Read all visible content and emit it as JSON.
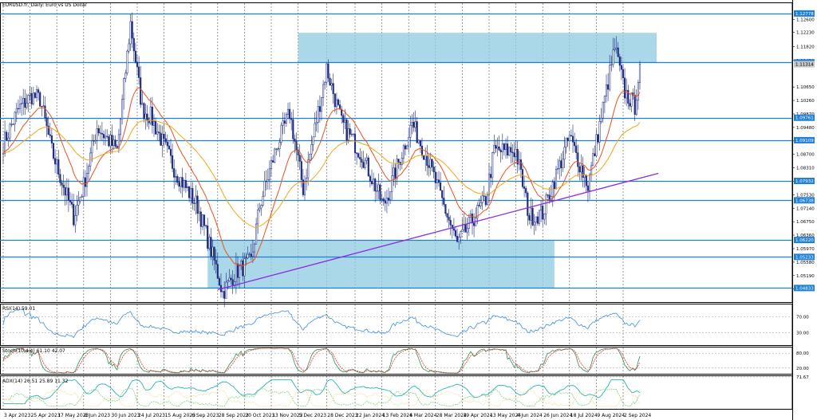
{
  "title": "EURUSD.fr, Daily: Euro vs US Dollar",
  "colors": {
    "bull": "#1c2a80",
    "bear": "#1c2a80",
    "level": "#1e7fd6",
    "zone": "#8fcbe0",
    "ema_fast": "#e8521d",
    "ema_slow": "#f2a619",
    "trendline": "#8a2be2",
    "rsi": "#3a8ee6",
    "stoch_main": "#2e8b57",
    "stoch_signal": "#d33",
    "adx": "#1aa",
    "plus_di": "#7fd27f",
    "minus_di": "#f5d37a"
  },
  "price_axis": {
    "min": 1.044,
    "max": 1.131,
    "ticks": [
      "1.12600",
      "1.12230",
      "1.11820",
      "1.11420",
      "1.10650",
      "1.10260",
      "1.09870",
      "1.09480",
      "1.09090",
      "1.08700",
      "1.08310",
      "1.07920",
      "1.07530",
      "1.07140",
      "1.06750",
      "1.06360",
      "1.05970",
      "1.05580",
      "1.05190",
      "1.04800"
    ]
  },
  "levels": [
    {
      "price": 1.1278,
      "label": "1.12778"
    },
    {
      "price": 1.1136,
      "label": "1.11363"
    },
    {
      "price": 1.0976,
      "label": "1.09761"
    },
    {
      "price": 1.0911,
      "label": "1.09109"
    },
    {
      "price": 1.0793,
      "label": "1.07932"
    },
    {
      "price": 1.0737,
      "label": "1.06738"
    },
    {
      "price": 1.0622,
      "label": "1.06220"
    },
    {
      "price": 1.0573,
      "label": "1.05233"
    },
    {
      "price": 1.0483,
      "label": "1.04833"
    }
  ],
  "current_price": {
    "price": 1.1131,
    "label": "1.11314"
  },
  "x_axis": {
    "labels": [
      "3 Apr 2023",
      "25 Apr 2023",
      "17 May 2023",
      "8 Jun 2023",
      "30 Jun 2023",
      "24 Jul 2023",
      "15 Aug 2023",
      "6 Sep 2023",
      "28 Sep 2023",
      "20 Oct 2023",
      "13 Nov 2023",
      "5 Dec 2023",
      "28 Dec 2023",
      "22 Jan 2024",
      "13 Feb 2024",
      "6 Mar 2024",
      "28 Mar 2024",
      "19 Apr 2024",
      "13 May 2024",
      "4 Jun 2024",
      "26 Jun 2024",
      "18 Jul 2024",
      "9 Aug 2024",
      "2 Sep 2024"
    ]
  },
  "indicators": {
    "rsi": {
      "label": "RSI(14) 59.01",
      "ticks": [
        "100.00",
        "70.00",
        "30.00",
        "0.00"
      ],
      "value": 59.01
    },
    "stoch": {
      "label": "Stoch(10,4,4) 61.10 42.07",
      "ticks": [
        "100.00",
        "80.00",
        "20.00",
        "0.00"
      ],
      "main": 61.1,
      "signal": 42.07
    },
    "adx": {
      "label": "ADX(14) 26.51 25.89 11.32",
      "ticks": [
        "71.67",
        "0.00"
      ],
      "adx": 26.51,
      "plus_di": 25.89,
      "minus_di": 11.32
    }
  },
  "chart_data": {
    "type": "candlestick",
    "title": "EURUSD.fr, Daily: Euro vs US Dollar",
    "x": [
      "3 Apr 2023",
      "25 Apr 2023",
      "17 May 2023",
      "8 Jun 2023",
      "30 Jun 2023",
      "24 Jul 2023",
      "15 Aug 2023",
      "6 Sep 2023",
      "28 Sep 2023",
      "20 Oct 2023",
      "13 Nov 2023",
      "5 Dec 2023",
      "28 Dec 2023",
      "22 Jan 2024",
      "13 Feb 2024",
      "6 Mar 2024",
      "28 Mar 2024",
      "19 Apr 2024",
      "13 May 2024",
      "4 Jun 2024",
      "26 Jun 2024",
      "18 Jul 2024",
      "9 Aug 2024",
      "2 Sep 2024"
    ],
    "path_anchors": [
      {
        "date": "3 Apr 2023",
        "price": 1.09
      },
      {
        "date": "14 Apr 2023",
        "price": 1.1
      },
      {
        "date": "26 Apr 2023",
        "price": 1.104
      },
      {
        "date": "3 May 2023",
        "price": 1.103
      },
      {
        "date": "12 May 2023",
        "price": 1.088
      },
      {
        "date": "31 May 2023",
        "price": 1.069
      },
      {
        "date": "8 Jun 2023",
        "price": 1.078
      },
      {
        "date": "20 Jun 2023",
        "price": 1.095
      },
      {
        "date": "6 Jul 2023",
        "price": 1.088
      },
      {
        "date": "18 Jul 2023",
        "price": 1.125
      },
      {
        "date": "27 Jul 2023",
        "price": 1.1
      },
      {
        "date": "3 Aug 2023",
        "price": 1.098
      },
      {
        "date": "24 Aug 2023",
        "price": 1.082
      },
      {
        "date": "12 Sep 2023",
        "price": 1.072
      },
      {
        "date": "26 Sep 2023",
        "price": 1.056
      },
      {
        "date": "3 Oct 2023",
        "price": 1.047
      },
      {
        "date": "13 Oct 2023",
        "price": 1.053
      },
      {
        "date": "26 Oct 2023",
        "price": 1.056
      },
      {
        "date": "2 Nov 2023",
        "price": 1.072
      },
      {
        "date": "16 Nov 2023",
        "price": 1.089
      },
      {
        "date": "28 Nov 2023",
        "price": 1.099
      },
      {
        "date": "8 Dec 2023",
        "price": 1.077
      },
      {
        "date": "28 Dec 2023",
        "price": 1.112
      },
      {
        "date": "10 Jan 2024",
        "price": 1.096
      },
      {
        "date": "26 Jan 2024",
        "price": 1.087
      },
      {
        "date": "14 Feb 2024",
        "price": 1.072
      },
      {
        "date": "8 Mar 2024",
        "price": 1.096
      },
      {
        "date": "21 Mar 2024",
        "price": 1.086
      },
      {
        "date": "16 Apr 2024",
        "price": 1.061
      },
      {
        "date": "9 May 2024",
        "price": 1.074
      },
      {
        "date": "16 May 2024",
        "price": 1.088
      },
      {
        "date": "4 Jun 2024",
        "price": 1.088
      },
      {
        "date": "14 Jun 2024",
        "price": 1.069
      },
      {
        "date": "26 Jun 2024",
        "price": 1.07
      },
      {
        "date": "18 Jul 2024",
        "price": 1.092
      },
      {
        "date": "2 Aug 2024",
        "price": 1.078
      },
      {
        "date": "26 Aug 2024",
        "price": 1.118
      },
      {
        "date": "3 Sep 2024",
        "price": 1.105
      },
      {
        "date": "11 Sep 2024",
        "price": 1.101
      },
      {
        "date": "16 Sep 2024",
        "price": 1.1131
      }
    ],
    "zones": [
      {
        "from": "5 Dec 2023",
        "to_date": "30 Sep 2024",
        "low": 1.1136,
        "high": 1.1222
      },
      {
        "from": "20 Sep 2023",
        "to_date": "5 Jul 2024",
        "low": 1.0483,
        "high": 1.0622
      }
    ],
    "trendline": {
      "start_date": "28 Sep 2023",
      "start_price": 1.0478,
      "end_date": "1 Oct 2024",
      "end_price": 1.0815
    },
    "xlabel": "",
    "ylabel": "",
    "grid": true
  }
}
